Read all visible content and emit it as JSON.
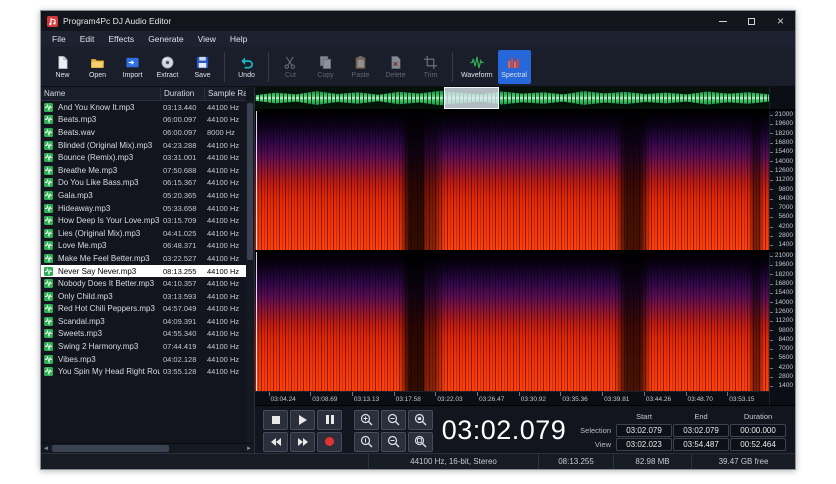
{
  "window": {
    "title": "Program4Pc DJ Audio Editor",
    "close_glyph": "×"
  },
  "menu": {
    "items": [
      {
        "label": "File"
      },
      {
        "label": "Edit"
      },
      {
        "label": "Effects"
      },
      {
        "label": "Generate"
      },
      {
        "label": "View"
      },
      {
        "label": "Help"
      }
    ]
  },
  "toolbar": {
    "buttons": [
      {
        "label": "New",
        "icon": "new-file-icon",
        "state": "enabled"
      },
      {
        "label": "Open",
        "icon": "open-folder-icon",
        "state": "enabled"
      },
      {
        "label": "Import",
        "icon": "import-icon",
        "state": "enabled"
      },
      {
        "label": "Extract",
        "icon": "extract-cd-icon",
        "state": "enabled"
      },
      {
        "label": "Save",
        "icon": "save-floppy-icon",
        "state": "enabled"
      },
      {
        "label": "Undo",
        "icon": "undo-arrow-icon",
        "state": "enabled"
      },
      {
        "label": "Cut",
        "icon": "cut-scissors-icon",
        "state": "disabled"
      },
      {
        "label": "Copy",
        "icon": "copy-icon",
        "state": "disabled"
      },
      {
        "label": "Paste",
        "icon": "paste-clipboard-icon",
        "state": "disabled"
      },
      {
        "label": "Delete",
        "icon": "delete-icon",
        "state": "disabled"
      },
      {
        "label": "Trim",
        "icon": "trim-crop-icon",
        "state": "disabled"
      },
      {
        "label": "Waveform",
        "icon": "waveform-icon",
        "state": "enabled"
      },
      {
        "label": "Spectral",
        "icon": "spectral-bars-icon",
        "state": "active"
      }
    ]
  },
  "file_list": {
    "columns": {
      "name": "Name",
      "duration": "Duration",
      "sample_rate": "Sample Rate"
    },
    "rows": [
      {
        "name": "And You Know It.mp3",
        "duration": "03:13.440",
        "sample_rate": "44100 Hz"
      },
      {
        "name": "Beats.mp3",
        "duration": "06:00.097",
        "sample_rate": "44100 Hz"
      },
      {
        "name": "Beats.wav",
        "duration": "06:00.097",
        "sample_rate": "8000 Hz"
      },
      {
        "name": "Blinded (Original Mix).mp3",
        "duration": "04:23.288",
        "sample_rate": "44100 Hz"
      },
      {
        "name": "Bounce (Remix).mp3",
        "duration": "03:31.001",
        "sample_rate": "44100 Hz"
      },
      {
        "name": "Breathe Me.mp3",
        "duration": "07:50.688",
        "sample_rate": "44100 Hz"
      },
      {
        "name": "Do You Like Bass.mp3",
        "duration": "06:15.367",
        "sample_rate": "44100 Hz"
      },
      {
        "name": "Gala.mp3",
        "duration": "05:20.365",
        "sample_rate": "44100 Hz"
      },
      {
        "name": "Hideaway.mp3",
        "duration": "05:33.658",
        "sample_rate": "44100 Hz"
      },
      {
        "name": "How Deep Is Your Love.mp3",
        "duration": "03:15.709",
        "sample_rate": "44100 Hz"
      },
      {
        "name": "Lies (Original Mix).mp3",
        "duration": "04:41.025",
        "sample_rate": "44100 Hz"
      },
      {
        "name": "Love Me.mp3",
        "duration": "06:48.371",
        "sample_rate": "44100 Hz"
      },
      {
        "name": "Make Me Feel Better.mp3",
        "duration": "03:22.527",
        "sample_rate": "44100 Hz"
      },
      {
        "name": "Never Say Never.mp3",
        "duration": "08:13.255",
        "sample_rate": "44100 Hz",
        "selected": true
      },
      {
        "name": "Nobody Does It Better.mp3",
        "duration": "04:10.357",
        "sample_rate": "44100 Hz"
      },
      {
        "name": "Only Child.mp3",
        "duration": "03:13.593",
        "sample_rate": "44100 Hz"
      },
      {
        "name": "Red Hot Chili Peppers.mp3",
        "duration": "04:57.049",
        "sample_rate": "44100 Hz"
      },
      {
        "name": "Scandal.mp3",
        "duration": "04:09.391",
        "sample_rate": "44100 Hz"
      },
      {
        "name": "Sweets.mp3",
        "duration": "04:55.340",
        "sample_rate": "44100 Hz"
      },
      {
        "name": "Swing 2 Harmony.mp3",
        "duration": "07:44.419",
        "sample_rate": "44100 Hz"
      },
      {
        "name": "Vibes.mp3",
        "duration": "04:02.128",
        "sample_rate": "44100 Hz"
      },
      {
        "name": "You Spin My Head Right Round...",
        "duration": "03:55.128",
        "sample_rate": "44100 Hz"
      }
    ]
  },
  "spectral": {
    "frequency_labels": [
      {
        "v": "21000"
      },
      {
        "v": "19600"
      },
      {
        "v": "18200"
      },
      {
        "v": "16800"
      },
      {
        "v": "15400"
      },
      {
        "v": "14000"
      },
      {
        "v": "12600"
      },
      {
        "v": "11200"
      },
      {
        "v": "9800"
      },
      {
        "v": "8400"
      },
      {
        "v": "7000"
      },
      {
        "v": "5600"
      },
      {
        "v": "4200"
      },
      {
        "v": "2800"
      },
      {
        "v": "1400"
      }
    ],
    "time_labels": [
      {
        "v": "03:04.24"
      },
      {
        "v": "03:08.69"
      },
      {
        "v": "03:13.13"
      },
      {
        "v": "03:17.58"
      },
      {
        "v": "03:22.03"
      },
      {
        "v": "03:26.47"
      },
      {
        "v": "03:30.92"
      },
      {
        "v": "03:35.36"
      },
      {
        "v": "03:39.81"
      },
      {
        "v": "03:44.26"
      },
      {
        "v": "03:48.70"
      },
      {
        "v": "03:53.15"
      }
    ]
  },
  "transport": {
    "time_display": "03:02.079",
    "buttons": [
      "stop",
      "play",
      "pause",
      "zoom-in",
      "zoom-out",
      "zoom-selection",
      "rewind",
      "fast-forward",
      "record",
      "zoom-in-2",
      "zoom-out-2",
      "zoom-full"
    ]
  },
  "range_panel": {
    "headers": [
      "Start",
      "End",
      "Duration"
    ],
    "rows": [
      {
        "label": "Selection",
        "start": "03:02.079",
        "end": "03:02.079",
        "duration": "00:00.000"
      },
      {
        "label": "View",
        "start": "03:02.023",
        "end": "03:54.487",
        "duration": "00:52.464"
      }
    ]
  },
  "status_bar": {
    "segments": [
      {
        "text": "44100 Hz, 16-bit, Stereo"
      },
      {
        "text": "08:13.255"
      },
      {
        "text": "82.98 MB"
      },
      {
        "text": "39.47 GB free"
      }
    ]
  },
  "colors": {
    "accent_blue": "#2667d9",
    "waveform_green": "#2fae54",
    "spectral_hot": "#ff400c",
    "record_red": "#e03434"
  }
}
